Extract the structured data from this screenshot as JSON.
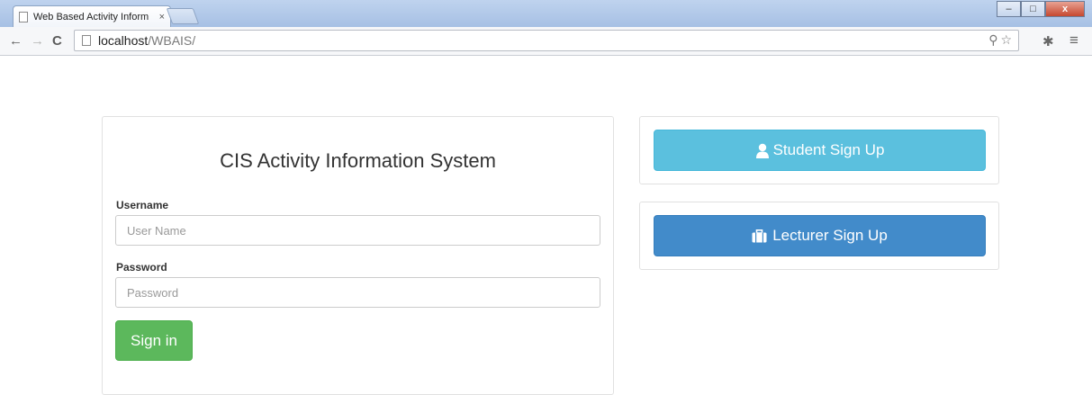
{
  "browser": {
    "tab_title": "Web Based Activity Inform",
    "tab_close": "×",
    "url_host": "localhost",
    "url_path": "/WBAIS/"
  },
  "login": {
    "title": "CIS Activity Information System",
    "username_label": "Username",
    "username_placeholder": "User Name",
    "password_label": "Password",
    "password_placeholder": "Password",
    "signin_label": "Sign in"
  },
  "signup": {
    "student_label": "Student Sign Up",
    "student_icon": "user-icon",
    "lecturer_label": "Lecturer Sign Up",
    "lecturer_icon": "briefcase-icon"
  },
  "colors": {
    "success": "#5cb85c",
    "info": "#5bc0de",
    "primary": "#428bca"
  }
}
